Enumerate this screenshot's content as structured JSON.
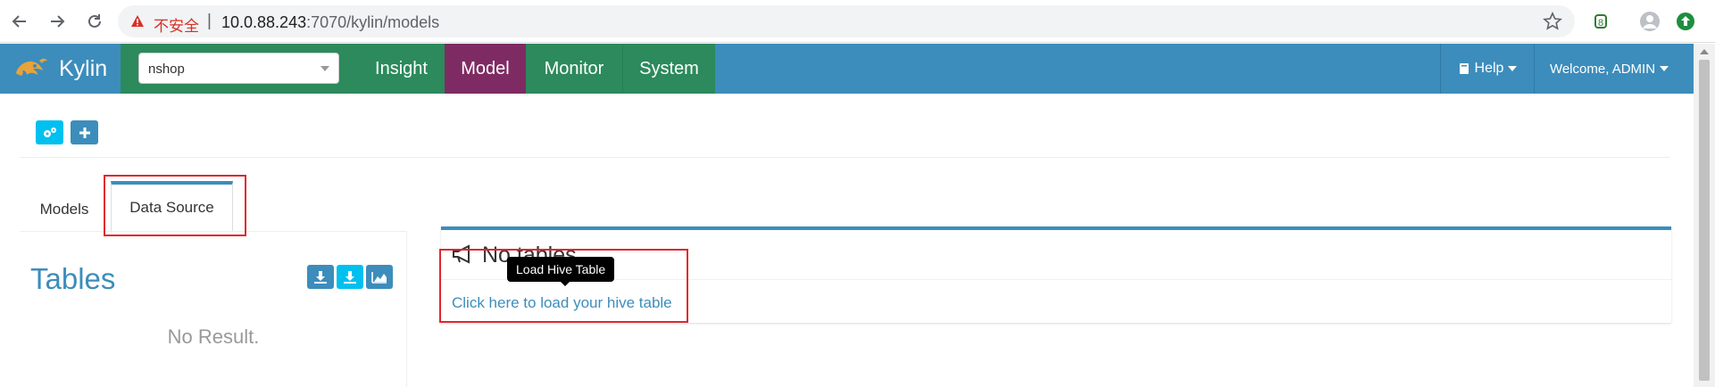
{
  "browser": {
    "insecure_label": "不安全",
    "separator": "|",
    "url_host": "10.0.88.243",
    "url_rest": ":7070/kylin/models"
  },
  "navbar": {
    "brand": "Kylin",
    "project_select": "nshop",
    "items": [
      {
        "label": "Insight",
        "active": false
      },
      {
        "label": "Model",
        "active": true
      },
      {
        "label": "Monitor",
        "active": false
      },
      {
        "label": "System",
        "active": false
      }
    ],
    "help_label": "Help",
    "welcome_label": "Welcome, ADMIN",
    "colors": {
      "bar": "#3c8dbc",
      "project_area": "#2c8a5c",
      "active_item": "#7f2b63"
    }
  },
  "left_panel": {
    "tabs": [
      {
        "label": "Models",
        "active": false
      },
      {
        "label": "Data Source",
        "active": true
      }
    ],
    "tables_title": "Tables",
    "table_buttons": [
      "load-hive-table-icon",
      "load-hive-table-2-icon",
      "sample-data-icon"
    ],
    "empty_text": "No Result."
  },
  "main_panel": {
    "title": "No tables",
    "tooltip": "Load Hive Table",
    "load_link": "Click here to load your hive table"
  },
  "annotation_color": "#e0272f"
}
